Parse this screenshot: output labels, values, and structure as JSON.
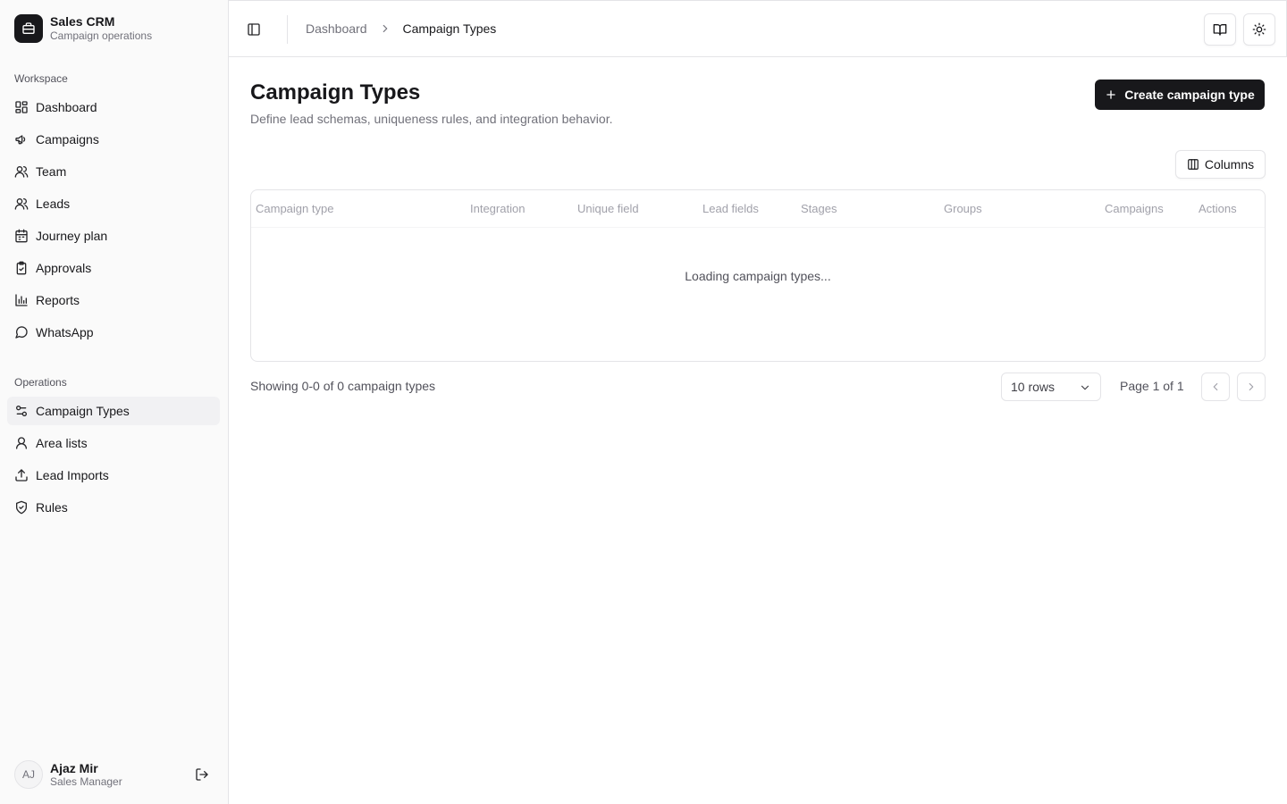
{
  "brand": {
    "title": "Sales CRM",
    "subtitle": "Campaign operations"
  },
  "sidebar": {
    "workspace_label": "Workspace",
    "workspace_items": [
      {
        "label": "Dashboard",
        "icon": "layout-grid-icon"
      },
      {
        "label": "Campaigns",
        "icon": "megaphone-icon"
      },
      {
        "label": "Team",
        "icon": "users-icon"
      },
      {
        "label": "Leads",
        "icon": "users-icon"
      },
      {
        "label": "Journey plan",
        "icon": "calendar-icon"
      },
      {
        "label": "Approvals",
        "icon": "clipboard-check-icon"
      },
      {
        "label": "Reports",
        "icon": "bar-chart-icon"
      },
      {
        "label": "WhatsApp",
        "icon": "message-circle-icon"
      }
    ],
    "operations_label": "Operations",
    "operations_items": [
      {
        "label": "Campaign Types",
        "icon": "sliders-icon",
        "active": true
      },
      {
        "label": "Area lists",
        "icon": "user-pin-icon"
      },
      {
        "label": "Lead Imports",
        "icon": "upload-icon"
      },
      {
        "label": "Rules",
        "icon": "shield-check-icon"
      }
    ]
  },
  "user": {
    "initials": "AJ",
    "name": "Ajaz Mir",
    "role": "Sales Manager"
  },
  "breadcrumb": {
    "parent": "Dashboard",
    "current": "Campaign Types"
  },
  "page": {
    "title": "Campaign Types",
    "description": "Define lead schemas, uniqueness rules, and integration behavior.",
    "create_label": "Create campaign type",
    "columns_label": "Columns"
  },
  "table": {
    "columns": [
      "Campaign type",
      "Integration",
      "Unique field",
      "Lead fields",
      "Stages",
      "Groups",
      "Campaigns",
      "Actions"
    ],
    "loading_text": "Loading campaign types..."
  },
  "pagination": {
    "showing_text": "Showing 0-0 of 0 campaign types",
    "rows_value": "10 rows",
    "page_text": "Page 1 of 1"
  },
  "colors": {
    "primary": "#18181b",
    "muted_text": "#71717a",
    "border": "#e4e4e7"
  }
}
